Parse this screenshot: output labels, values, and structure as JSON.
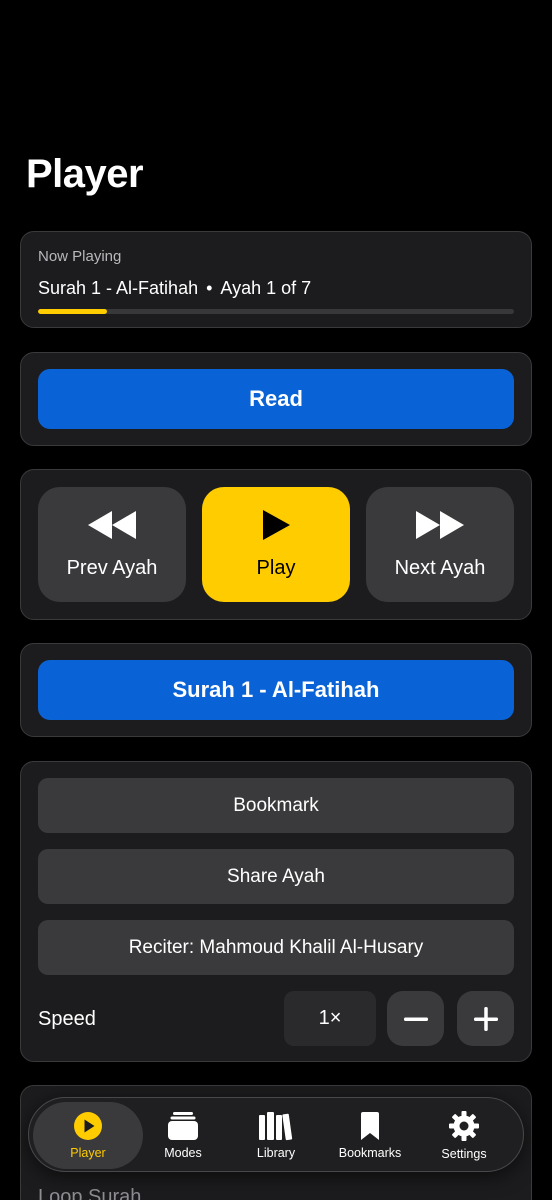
{
  "page": {
    "title": "Player"
  },
  "now_playing": {
    "label": "Now Playing",
    "surah": "Surah 1 - Al-Fatihah",
    "separator": "•",
    "ayah": "Ayah 1 of 7",
    "progress": 0.145
  },
  "read_button": {
    "label": "Read"
  },
  "controls": {
    "prev": {
      "label": "Prev Ayah",
      "icon": "backward-icon"
    },
    "play": {
      "label": "Play",
      "icon": "play-icon"
    },
    "next": {
      "label": "Next Ayah",
      "icon": "forward-icon"
    }
  },
  "surah_button": {
    "label": "Surah 1 - Al-Fatihah"
  },
  "options": {
    "bookmark": "Bookmark",
    "share": "Share Ayah",
    "reciter": "Reciter: Mahmoud Khalil Al-Husary",
    "speed_label": "Speed",
    "speed_value": "1×"
  },
  "bottom_card": {
    "loop_label": "Loop Surah"
  },
  "tabbar": {
    "items": [
      {
        "label": "Player",
        "icon": "play-circle-icon",
        "active": true
      },
      {
        "label": "Modes",
        "icon": "stack-icon",
        "active": false
      },
      {
        "label": "Library",
        "icon": "books-icon",
        "active": false
      },
      {
        "label": "Bookmarks",
        "icon": "bookmark-icon",
        "active": false
      },
      {
        "label": "Settings",
        "icon": "gear-icon",
        "active": false
      }
    ]
  },
  "colors": {
    "accent": "#ffcc00",
    "primary_blue": "#0a63d6",
    "card_bg": "#1c1c1e",
    "button_bg": "#3a3a3c"
  }
}
